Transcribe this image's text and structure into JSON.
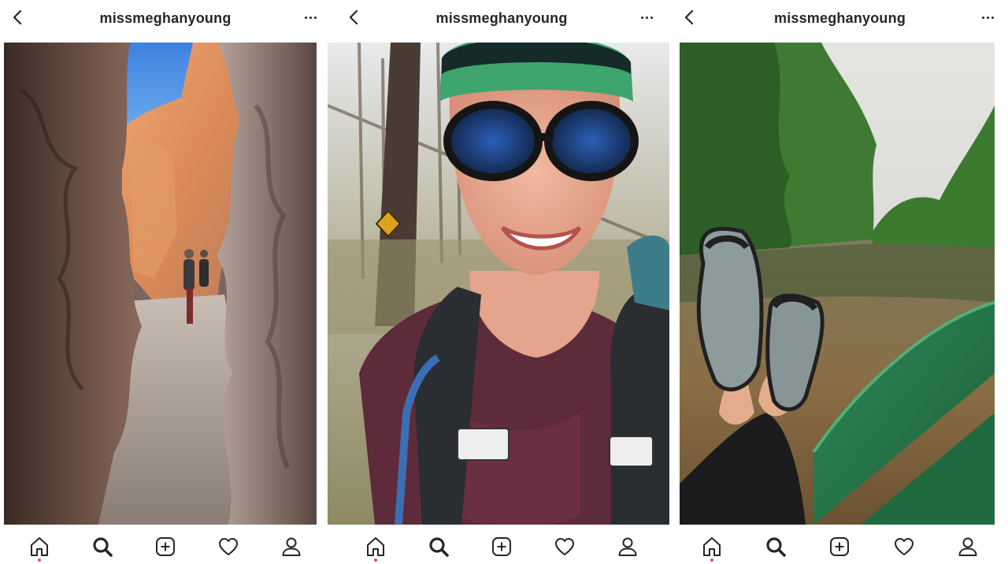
{
  "panels": [
    {
      "header": {
        "username": "missmeghanyoung",
        "back_icon": "chevron-left-icon",
        "more_icon": "more-horizontal-icon"
      },
      "photo": {
        "subject": "slot canyon hikers"
      },
      "nav": [
        {
          "icon": "home-icon",
          "active": true,
          "notification_dot": true
        },
        {
          "icon": "search-icon",
          "active": true
        },
        {
          "icon": "add-post-icon"
        },
        {
          "icon": "heart-icon"
        },
        {
          "icon": "profile-icon"
        }
      ]
    },
    {
      "header": {
        "username": "missmeghanyoung",
        "back_icon": "chevron-left-icon",
        "more_icon": "more-horizontal-icon"
      },
      "photo": {
        "subject": "selfie with helmet and sunglasses"
      },
      "nav": [
        {
          "icon": "home-icon",
          "active": true,
          "notification_dot": true
        },
        {
          "icon": "search-icon",
          "active": true
        },
        {
          "icon": "add-post-icon"
        },
        {
          "icon": "heart-icon"
        },
        {
          "icon": "profile-icon"
        }
      ]
    },
    {
      "header": {
        "username": "missmeghanyoung",
        "back_icon": "chevron-left-icon",
        "more_icon": "more-horizontal-icon"
      },
      "photo": {
        "subject": "feet on boat on jungle river"
      },
      "nav": [
        {
          "icon": "home-icon",
          "active": true,
          "notification_dot": true
        },
        {
          "icon": "search-icon",
          "active": true
        },
        {
          "icon": "add-post-icon"
        },
        {
          "icon": "heart-icon"
        },
        {
          "icon": "profile-icon"
        }
      ]
    }
  ],
  "colors": {
    "text": "#262626",
    "notification": "#ed4956",
    "background": "#ffffff"
  }
}
